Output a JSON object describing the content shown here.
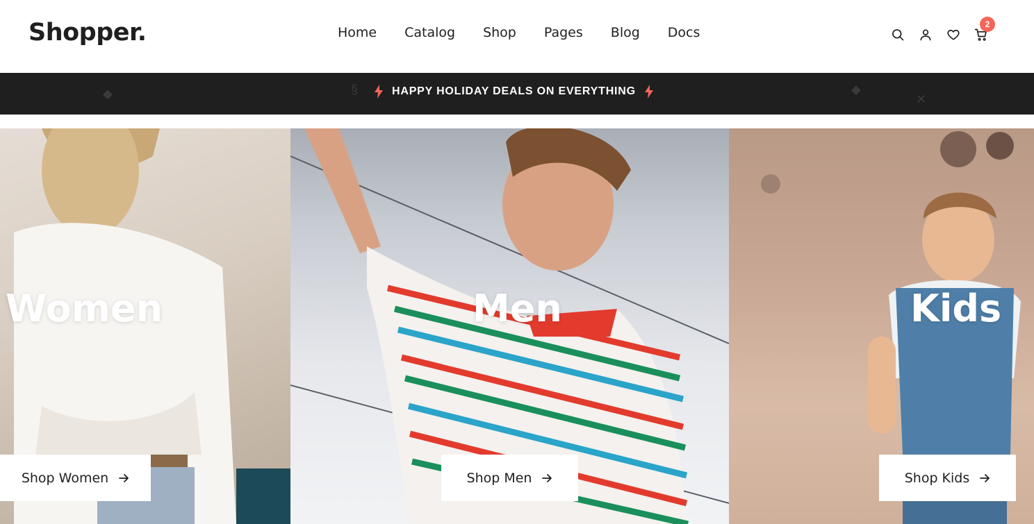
{
  "brand": {
    "logo": "Shopper."
  },
  "nav": [
    {
      "label": "Home"
    },
    {
      "label": "Catalog"
    },
    {
      "label": "Shop"
    },
    {
      "label": "Pages"
    },
    {
      "label": "Blog"
    },
    {
      "label": "Docs"
    }
  ],
  "header_icons": {
    "search": "search-icon",
    "account": "user-icon",
    "wishlist": "heart-icon",
    "cart": "cart-icon",
    "cart_count": "2"
  },
  "promo": {
    "text": "HAPPY HOLIDAY DEALS ON EVERYTHING",
    "icon": "lightning-icon",
    "accent_color": "#f4655a"
  },
  "categories": [
    {
      "title": "Women",
      "cta": "Shop Women"
    },
    {
      "title": "Men",
      "cta": "Shop Men"
    },
    {
      "title": "Kids",
      "cta": "Shop Kids"
    }
  ],
  "colors": {
    "dark": "#1f1f1f",
    "badge": "#f4655a",
    "white": "#ffffff"
  }
}
